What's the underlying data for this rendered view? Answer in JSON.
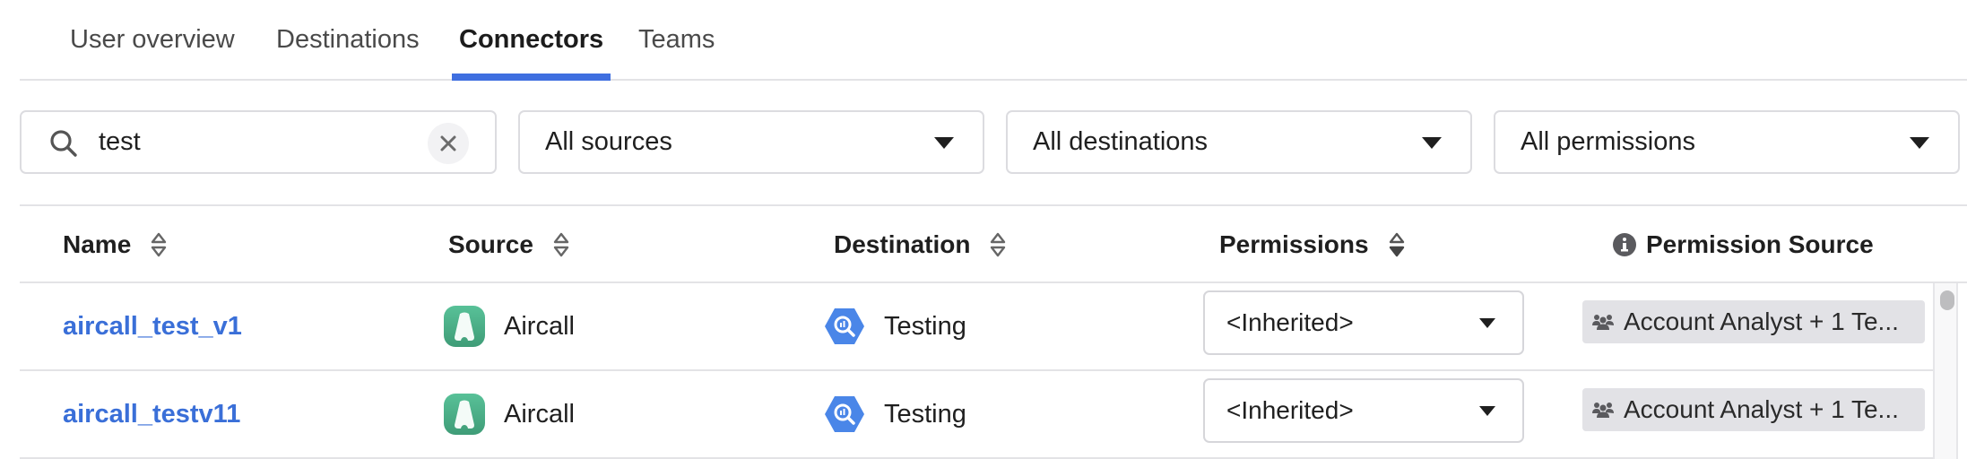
{
  "tabs": [
    {
      "label": "User overview",
      "active": false
    },
    {
      "label": "Destinations",
      "active": false
    },
    {
      "label": "Connectors",
      "active": true
    },
    {
      "label": "Teams",
      "active": false
    }
  ],
  "filters": {
    "search": {
      "value": "test",
      "icon": "search-icon",
      "clear_icon": "close-icon"
    },
    "sources": {
      "selected": "All sources"
    },
    "destinations": {
      "selected": "All destinations"
    },
    "permissions": {
      "selected": "All permissions"
    }
  },
  "table": {
    "columns": [
      {
        "label": "Name",
        "sortable": true,
        "sort_state": "none"
      },
      {
        "label": "Source",
        "sortable": true,
        "sort_state": "none"
      },
      {
        "label": "Destination",
        "sortable": true,
        "sort_state": "none"
      },
      {
        "label": "Permissions",
        "sortable": true,
        "sort_state": "descending"
      },
      {
        "label": "Permission Source",
        "icon": "info-icon"
      }
    ],
    "rows": [
      {
        "name": "aircall_test_v1",
        "source": {
          "label": "Aircall",
          "icon": "aircall-logo"
        },
        "destination": {
          "label": "Testing",
          "icon": "bigquery-logo"
        },
        "permission": "<Inherited>",
        "permission_source": "Account Analyst + 1 Te..."
      },
      {
        "name": "aircall_testv11",
        "source": {
          "label": "Aircall",
          "icon": "aircall-logo"
        },
        "destination": {
          "label": "Testing",
          "icon": "bigquery-logo"
        },
        "permission": "<Inherited>",
        "permission_source": "Account Analyst + 1 Te..."
      }
    ]
  },
  "colors": {
    "accent": "#3f6fe0",
    "link": "#3a6fd8",
    "aircall_green": "#4fb68c",
    "bigquery_blue": "#4a86e8",
    "chip_bg": "#e2e2e6"
  }
}
